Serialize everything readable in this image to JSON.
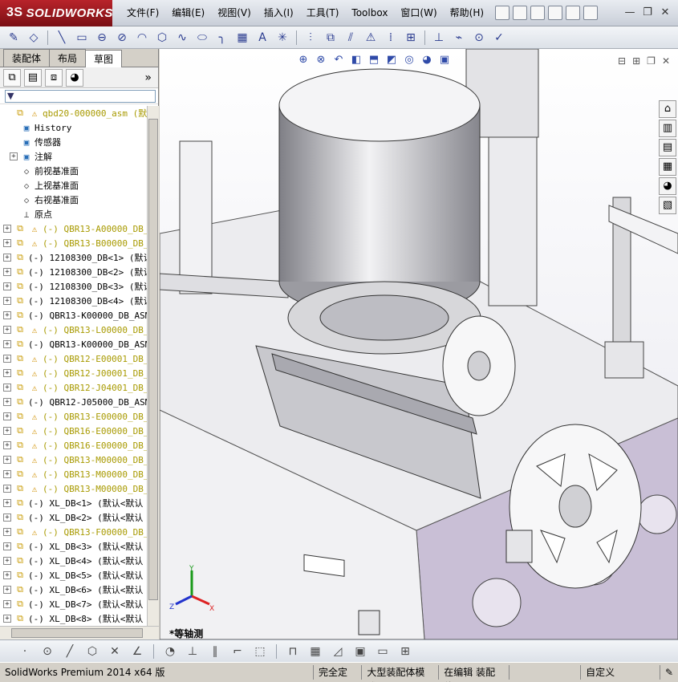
{
  "app": {
    "logo_prefix": "3S",
    "logo_text": "SOLIDWORKS"
  },
  "menu": [
    "文件(F)",
    "编辑(E)",
    "视图(V)",
    "插入(I)",
    "工具(T)",
    "Toolbox",
    "窗口(W)",
    "帮助(H)"
  ],
  "tabs": [
    "装配体",
    "布局",
    "草图"
  ],
  "active_tab": 2,
  "tree": [
    {
      "label": "qbd20-000000_asm  (默认<",
      "exp": "none",
      "icon": "asm",
      "warn": true,
      "warnrow": true
    },
    {
      "label": "History",
      "exp": "none",
      "icon": "folder",
      "indent": 1
    },
    {
      "label": "传感器",
      "exp": "none",
      "icon": "folder",
      "indent": 1
    },
    {
      "label": "注解",
      "exp": "+",
      "icon": "folder",
      "indent": 1
    },
    {
      "label": "前视基准面",
      "exp": "none",
      "icon": "plane",
      "indent": 1
    },
    {
      "label": "上视基准面",
      "exp": "none",
      "icon": "plane",
      "indent": 1
    },
    {
      "label": "右视基准面",
      "exp": "none",
      "icon": "plane",
      "indent": 1
    },
    {
      "label": "原点",
      "exp": "none",
      "icon": "origin",
      "indent": 1
    },
    {
      "label": "(-) QBR13-A00000_DB_",
      "exp": "+",
      "icon": "asm",
      "warn": true,
      "warnrow": true
    },
    {
      "label": "(-) QBR13-B00000_DB_",
      "exp": "+",
      "icon": "asm",
      "warn": true,
      "warnrow": true
    },
    {
      "label": "(-) 12108300_DB<1> (默认",
      "exp": "+",
      "icon": "asm"
    },
    {
      "label": "(-) 12108300_DB<2> (默认",
      "exp": "+",
      "icon": "asm"
    },
    {
      "label": "(-) 12108300_DB<3> (默认",
      "exp": "+",
      "icon": "asm"
    },
    {
      "label": "(-) 12108300_DB<4> (默认",
      "exp": "+",
      "icon": "asm"
    },
    {
      "label": "(-) QBR13-K00000_DB_ASM",
      "exp": "+",
      "icon": "asm"
    },
    {
      "label": "(-) QBR13-L00000_DB_",
      "exp": "+",
      "icon": "asm",
      "warn": true,
      "warnrow": true
    },
    {
      "label": "(-) QBR13-K00000_DB_ASM",
      "exp": "+",
      "icon": "asm"
    },
    {
      "label": "(-) QBR12-E00001_DB_",
      "exp": "+",
      "icon": "asm",
      "warn": true,
      "warnrow": true
    },
    {
      "label": "(-) QBR12-J00001_DB_",
      "exp": "+",
      "icon": "asm",
      "warn": true,
      "warnrow": true
    },
    {
      "label": "(-) QBR12-J04001_DB_",
      "exp": "+",
      "icon": "asm",
      "warn": true,
      "warnrow": true
    },
    {
      "label": "(-) QBR12-J05000_DB_ASM",
      "exp": "+",
      "icon": "asm"
    },
    {
      "label": "(-) QBR13-E00000_DB_",
      "exp": "+",
      "icon": "asm",
      "warn": true,
      "warnrow": true
    },
    {
      "label": "(-) QBR16-E00000_DB_",
      "exp": "+",
      "icon": "asm",
      "warn": true,
      "warnrow": true
    },
    {
      "label": "(-) QBR16-E00000_DB_",
      "exp": "+",
      "icon": "asm",
      "warn": true,
      "warnrow": true
    },
    {
      "label": "(-) QBR13-M00000_DB_",
      "exp": "+",
      "icon": "asm",
      "warn": true,
      "warnrow": true
    },
    {
      "label": "(-) QBR13-M00000_DB_",
      "exp": "+",
      "icon": "asm",
      "warn": true,
      "warnrow": true
    },
    {
      "label": "(-) QBR13-M00000_DB_",
      "exp": "+",
      "icon": "asm",
      "warn": true,
      "warnrow": true
    },
    {
      "label": "(-) XL_DB<1> (默认<默认",
      "exp": "+",
      "icon": "asm"
    },
    {
      "label": "(-) XL_DB<2> (默认<默认",
      "exp": "+",
      "icon": "asm"
    },
    {
      "label": "(-) QBR13-F00000_DB_",
      "exp": "+",
      "icon": "asm",
      "warn": true,
      "warnrow": true
    },
    {
      "label": "(-) XL_DB<3> (默认<默认",
      "exp": "+",
      "icon": "asm"
    },
    {
      "label": "(-) XL_DB<4> (默认<默认",
      "exp": "+",
      "icon": "asm"
    },
    {
      "label": "(-) XL_DB<5> (默认<默认",
      "exp": "+",
      "icon": "asm"
    },
    {
      "label": "(-) XL_DB<6> (默认<默认",
      "exp": "+",
      "icon": "asm"
    },
    {
      "label": "(-) XL_DB<7> (默认<默认",
      "exp": "+",
      "icon": "asm"
    },
    {
      "label": "(-) XL_DB<8> (默认<默认",
      "exp": "+",
      "icon": "asm"
    }
  ],
  "viewport": {
    "view_label": "*等轴测",
    "triad": {
      "x": "X",
      "y": "Y",
      "z": "Z"
    }
  },
  "status": {
    "product": "SolidWorks Premium 2014 x64 版",
    "fully_defined": "完全定义",
    "large_mode": "大型装配体模式",
    "editing": "在编辑 装配体",
    "custom": "自定义"
  },
  "colors": {
    "logo_bg": "#b8232a",
    "machine_purple": "#c9bfd6",
    "accent_blue": "#2a3b8f"
  }
}
